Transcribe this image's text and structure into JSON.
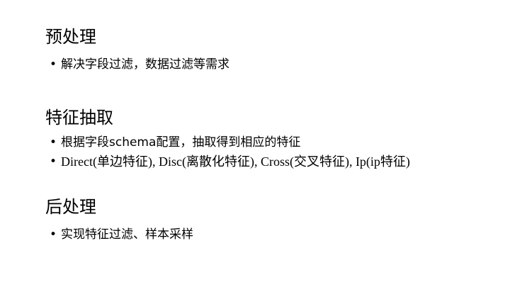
{
  "sections": [
    {
      "heading": "预处理",
      "bullets": [
        "解决字段过滤，数据过滤等需求"
      ]
    },
    {
      "heading": "特征抽取",
      "bullets": [
        "根据字段schema配置，抽取得到相应的特征",
        "Direct(单边特征), Disc(离散化特征), Cross(交叉特征), Ip(ip特征)"
      ]
    },
    {
      "heading": "后处理",
      "bullets": [
        "实现特征过滤、样本采样"
      ]
    }
  ],
  "bullet_glyph": "•"
}
